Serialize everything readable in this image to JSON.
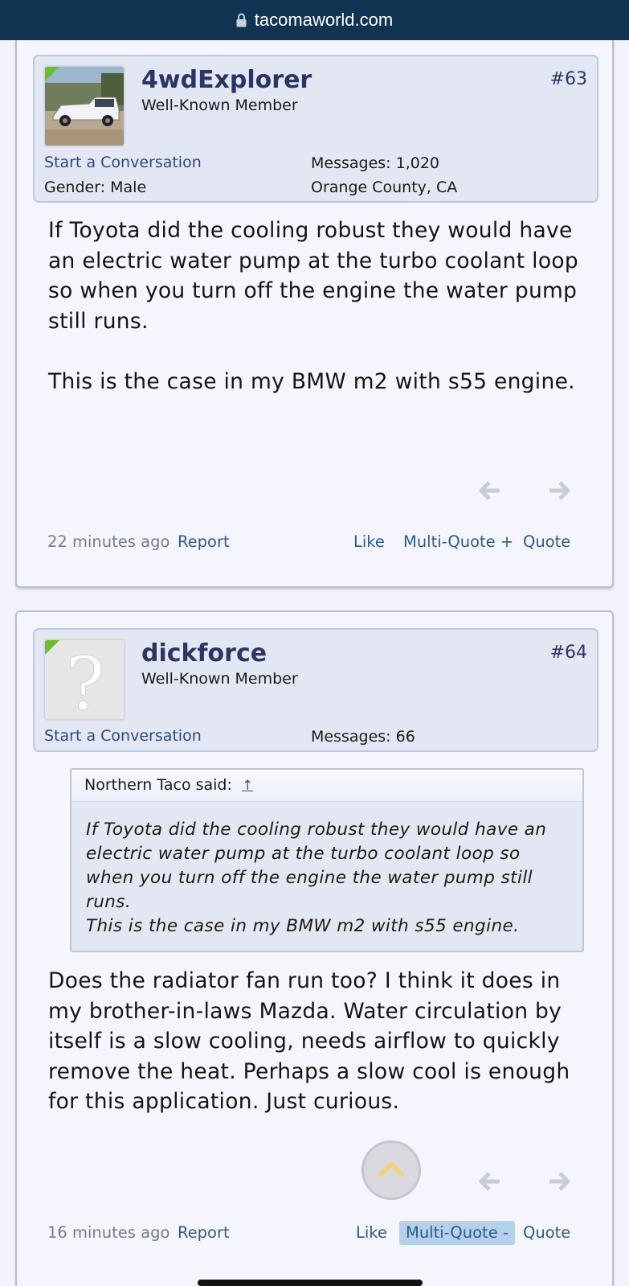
{
  "browser": {
    "url": "tacomaworld.com"
  },
  "posts": [
    {
      "username": "4wdExplorer",
      "user_title": "Well-Known Member",
      "post_number": "#63",
      "start_conversation": "Start a Conversation",
      "messages_label": "Messages:",
      "messages_count": "1,020",
      "gender": "Gender: Male",
      "location": "Orange County, CA",
      "body": [
        "If Toyota did the cooling robust they would have an electric water pump at the turbo coolant loop so when you turn off the engine the water pump still runs.",
        "This is the case in my BMW m2 with s55 engine."
      ],
      "time": "22 minutes ago",
      "report": "Report",
      "like": "Like",
      "multi_quote": "Multi-Quote +",
      "quote": "Quote"
    },
    {
      "username": "dickforce",
      "user_title": "Well-Known Member",
      "post_number": "#64",
      "start_conversation": "Start a Conversation",
      "messages_label": "Messages:",
      "messages_count": "66",
      "quote_author": "Northern Taco said:",
      "quote_up": "↑",
      "quote_text": "If Toyota did the cooling robust they would have an electric water pump at the turbo coolant loop so when you turn off the engine the water pump still runs.",
      "quote_text2": "This is the case in my BMW m2 with s55 engine.",
      "body": [
        "Does the radiator fan run too? I think it does in my brother-in-laws Mazda. Water circulation by itself is a slow cooling, needs airflow to quickly remove the heat. Perhaps a slow cool is enough for this application. Just curious."
      ],
      "time": "16 minutes ago",
      "report": "Report",
      "like": "Like",
      "multi_quote": "Multi-Quote -",
      "quote": "Quote"
    }
  ],
  "colors": {
    "topbar": "#0f3350",
    "userinfo_bg": "#e3e7f4",
    "link": "#2d5a8e",
    "username": "#2a3564"
  }
}
